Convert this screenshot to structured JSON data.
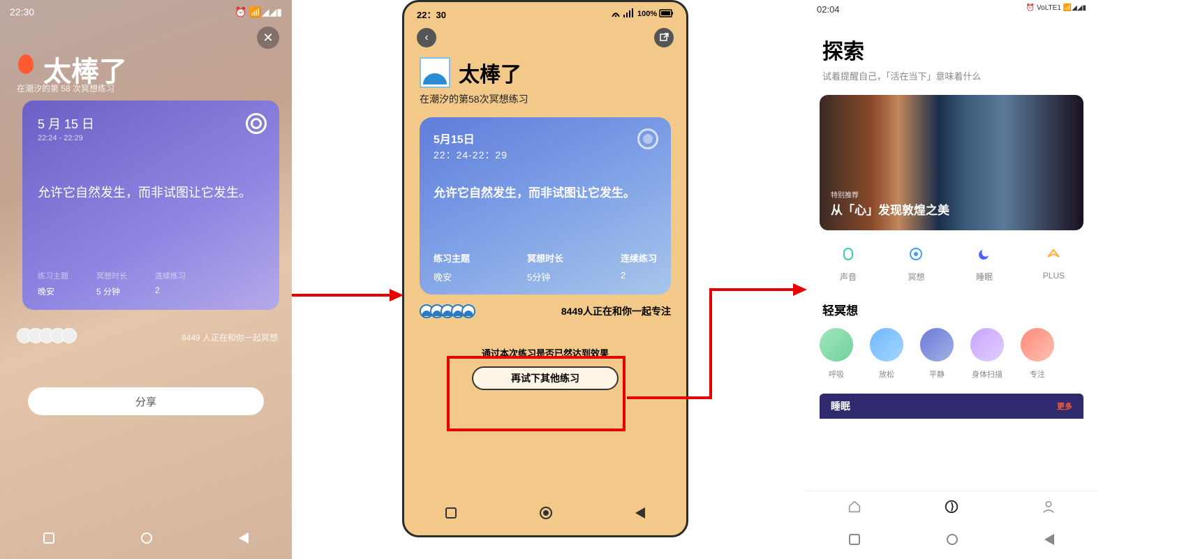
{
  "phone1": {
    "status_time": "22:30",
    "status_icons": "⏰ 📶◢◢▮",
    "title": "太棒了",
    "subtitle": "在潮汐的第 58 次冥想练习",
    "card": {
      "date": "5 月 15 日",
      "time": "22:24 - 22:29",
      "quote": "允许它自然发生，而非试图让它发生。",
      "stats": [
        {
          "label": "练习主题",
          "value": "晚安"
        },
        {
          "label": "冥想时长",
          "value": "5 分钟"
        },
        {
          "label": "连续练习",
          "value": "2"
        }
      ]
    },
    "count_text": "8449 人正在和你一起冥想",
    "share_label": "分享"
  },
  "phone2": {
    "status_time": "22：30",
    "status_battery": "100%",
    "title": "太棒了",
    "subtitle": "在潮汐的第58次冥想练习",
    "card": {
      "date": "5月15日",
      "time": "22：24-22：29",
      "quote": "允许它自然发生，而非试图让它发生。",
      "stats": [
        {
          "label": "练习主题",
          "value": "晚安"
        },
        {
          "label": "冥想时长",
          "value": "5分钟"
        },
        {
          "label": "连续练习",
          "value": "2"
        }
      ]
    },
    "count_text": "8449人正在和你一起专注",
    "effect_question": "通过本次练习是否已然达到效果",
    "retry_label": "再试下其他练习"
  },
  "phone3": {
    "status_time": "02:04",
    "status_icons": "⏰ VoLTE1 📶◢◢▮",
    "title": "探索",
    "subtitle": "试着提醒自己，「活在当下」意味着什么",
    "hero_tag": "特别推荐",
    "hero_title": "从「心」发现敦煌之美",
    "categories": [
      {
        "label": "声音",
        "color": "#39d0a7"
      },
      {
        "label": "冥想",
        "color": "#3aa0ff"
      },
      {
        "label": "睡眠",
        "color": "#4a5fff"
      },
      {
        "label": "PLUS",
        "color": "#ffb13a"
      }
    ],
    "light_meditation_title": "轻冥想",
    "meditations": [
      {
        "label": "呼吸",
        "color1": "#a3e6bd",
        "color2": "#6fd19a"
      },
      {
        "label": "放松",
        "color1": "#6fb8ff",
        "color2": "#a3d6ff"
      },
      {
        "label": "平静",
        "color1": "#6a7cd8",
        "color2": "#a3b0e6"
      },
      {
        "label": "身体扫描",
        "color1": "#c9a3ff",
        "color2": "#e0cfff"
      },
      {
        "label": "专注",
        "color1": "#ff8a7a",
        "color2": "#ffc0b0"
      }
    ],
    "sleep_title": "睡眠",
    "sleep_more": "更多"
  }
}
